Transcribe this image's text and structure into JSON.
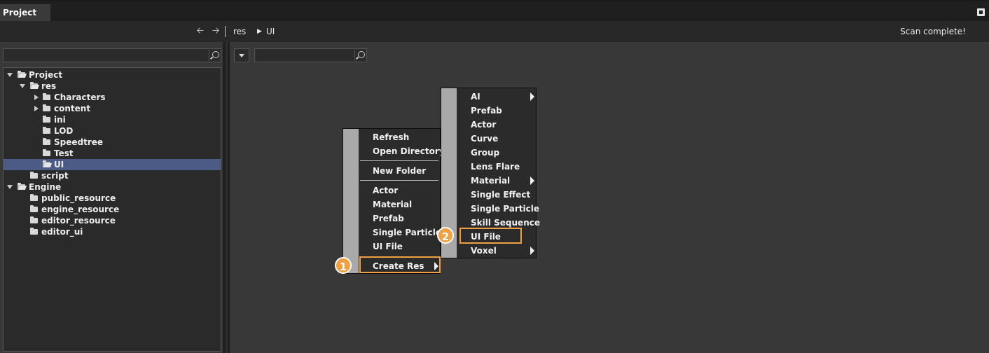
{
  "window": {
    "tab_label": "Project"
  },
  "navbar": {
    "breadcrumb": [
      "res",
      "UI"
    ],
    "status": "Scan complete!"
  },
  "left": {
    "search": {
      "value": "",
      "placeholder": ""
    },
    "tree": [
      {
        "label": "Project",
        "expanded": true
      },
      {
        "label": "res",
        "expanded": true
      },
      {
        "label": "Characters",
        "expanded": false
      },
      {
        "label": "content",
        "expanded": false
      },
      {
        "label": "ini"
      },
      {
        "label": "LOD"
      },
      {
        "label": "Speedtree"
      },
      {
        "label": "Test"
      },
      {
        "label": "UI",
        "selected": true
      },
      {
        "label": "script"
      },
      {
        "label": "Engine",
        "expanded": true
      },
      {
        "label": "public_resource"
      },
      {
        "label": "engine_resource"
      },
      {
        "label": "editor_resource"
      },
      {
        "label": "editor_ui"
      }
    ]
  },
  "right": {
    "search": {
      "value": "",
      "placeholder": ""
    }
  },
  "context_menu": {
    "items": [
      "Refresh",
      "Open Directory",
      "New Folder",
      "Actor",
      "Material",
      "Prefab",
      "Single Particle",
      "UI File",
      "Create Res"
    ]
  },
  "submenu": {
    "items": [
      "AI",
      "Prefab",
      "Actor",
      "Curve",
      "Group",
      "Lens Flare",
      "Material",
      "Single Effect",
      "Single Particle",
      "Skill Sequence",
      "UI File",
      "Voxel"
    ]
  },
  "annotations": {
    "step1": "1",
    "step2": "2",
    "highlight_color": "#f0a040"
  }
}
